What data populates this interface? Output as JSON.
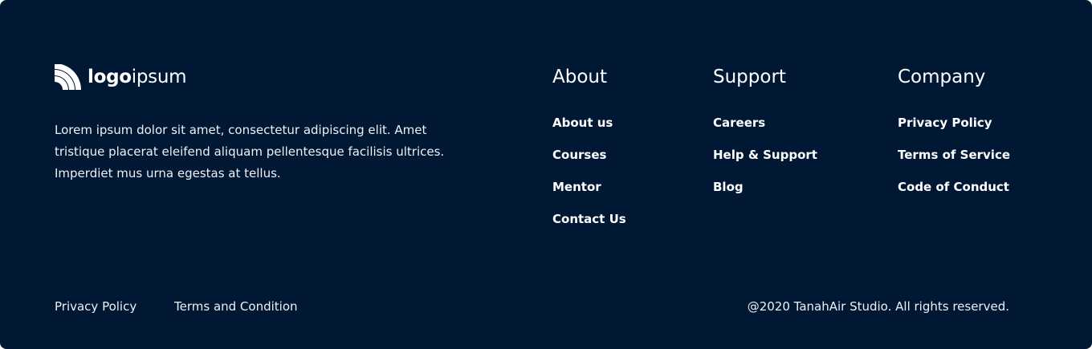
{
  "brand": {
    "logo_icon": "rss-arcs-icon",
    "logo_bold": "logo",
    "logo_light": "ipsum",
    "accent_color": "#ffffff",
    "background_color": "#001833"
  },
  "description": "Lorem ipsum dolor sit amet, consectetur adipiscing elit. Amet tristique placerat eleifend aliquam pellentesque facilisis ultrices. Imperdiet mus urna egestas at tellus.",
  "columns": [
    {
      "title": "About",
      "links": [
        "About us",
        "Courses",
        "Mentor",
        "Contact Us"
      ]
    },
    {
      "title": "Support",
      "links": [
        "Careers",
        "Help & Support",
        "Blog"
      ]
    },
    {
      "title": "Company",
      "links": [
        "Privacy Policy",
        "Terms of Service",
        "Code of Conduct"
      ]
    }
  ],
  "bottom": {
    "privacy_label": "Privacy Policy",
    "terms_label": "Terms and Condition",
    "copyright": "@2020 TanahAir Studio. All rights reserved."
  }
}
